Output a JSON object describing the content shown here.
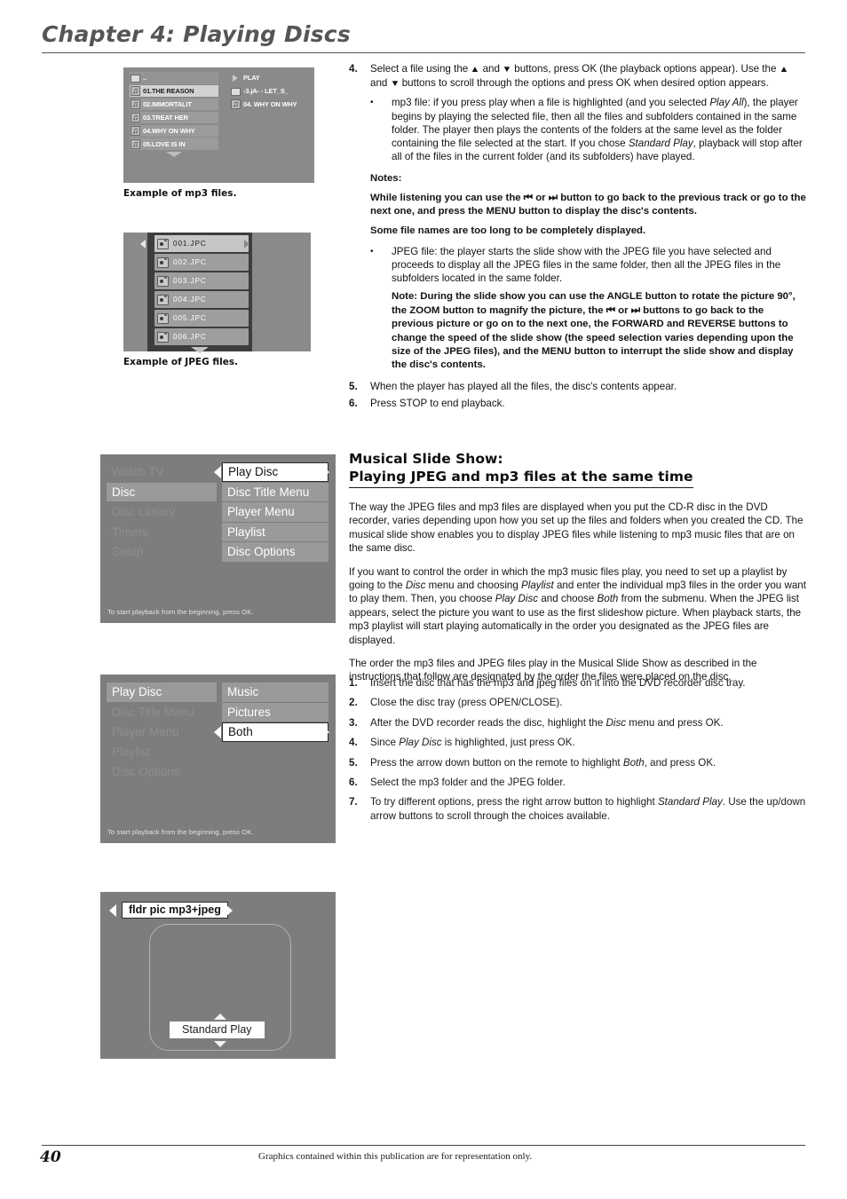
{
  "header": {
    "chapter_title": "Chapter 4: Playing Discs"
  },
  "figures": {
    "mp3": {
      "caption": "Example of mp3 files.",
      "left_list": [
        {
          "label": "..",
          "icon": "folder-icon",
          "selected": false
        },
        {
          "label": "01.THE REASON",
          "icon": "music-note-icon",
          "selected": true
        },
        {
          "label": "02.IMMORTALIT",
          "icon": "music-note-icon",
          "selected": false
        },
        {
          "label": "03.TREAT HER",
          "icon": "music-note-icon",
          "selected": false
        },
        {
          "label": "04.WHY ON WHY",
          "icon": "music-note-icon",
          "selected": false
        },
        {
          "label": "05.LOVE IS IN",
          "icon": "music-note-icon",
          "selected": false
        }
      ],
      "right_list": [
        {
          "label": "PLAY",
          "icon": "play-icon"
        },
        {
          "label": "-3.jA- - LET_S_",
          "icon": "folder-icon"
        },
        {
          "label": "04. WHY ON WHY",
          "icon": "music-note-icon"
        }
      ]
    },
    "jpeg": {
      "caption": "Example of JPEG files.",
      "files": [
        {
          "label": "001.JPC",
          "selected": true
        },
        {
          "label": "002.JPC",
          "selected": false
        },
        {
          "label": "003.JPC",
          "selected": false
        },
        {
          "label": "004.JPC",
          "selected": false
        },
        {
          "label": "005.JPC",
          "selected": false
        },
        {
          "label": "006.JPC",
          "selected": false
        }
      ]
    },
    "disc_menu": {
      "left_items": [
        {
          "label": "Watch TV",
          "state": "dim"
        },
        {
          "label": "Disc",
          "state": "active"
        },
        {
          "label": "Disc Library",
          "state": "dim"
        },
        {
          "label": "Timers",
          "state": "dim"
        },
        {
          "label": "Setup",
          "state": "dim"
        }
      ],
      "right_items": [
        {
          "label": "Play Disc",
          "state": "selected"
        },
        {
          "label": "Disc Title Menu",
          "state": "listed"
        },
        {
          "label": "Player Menu",
          "state": "listed"
        },
        {
          "label": "Playlist",
          "state": "listed"
        },
        {
          "label": "Disc Options",
          "state": "listed"
        }
      ],
      "hint": "To start playback from the beginning, press OK."
    },
    "play_disc_menu": {
      "left_items": [
        {
          "label": "Play Disc",
          "state": "active"
        },
        {
          "label": "Disc Title Menu",
          "state": "dim"
        },
        {
          "label": "Player Menu",
          "state": "dim"
        },
        {
          "label": "Playlist",
          "state": "dim"
        },
        {
          "label": "Disc Options",
          "state": "dim"
        }
      ],
      "right_items": [
        {
          "label": "Music",
          "state": "listed"
        },
        {
          "label": "Pictures",
          "state": "listed"
        },
        {
          "label": "Both",
          "state": "selected"
        }
      ],
      "hint": "To start playback from the beginning, press OK."
    },
    "slideshow": {
      "folder_label": "fldr pic mp3+jpeg",
      "play_mode_label": "Standard Play"
    }
  },
  "instructions": {
    "step4_num": "4.",
    "step4_text_a": "Select a file using the ",
    "step4_text_b": " and ",
    "step4_text_c": " buttons, press OK (the playback options appear). Use the ",
    "step4_text_d": " and ",
    "step4_text_e": " buttons to scroll through the options and press OK when desired option appears.",
    "bullet_mp3_a": "mp3 file: if you press play when a file is highlighted (and you selected ",
    "bullet_mp3_i1": "Play All",
    "bullet_mp3_b": "), the player begins by playing the selected file, then all the files and subfolders contained in the same folder. The player then plays the contents of the folders at the same level as the folder containing the file selected at the start. If you chose ",
    "bullet_mp3_i2": "Standard Play",
    "bullet_mp3_c": ", playback will stop after all of the files in the current folder (and its subfolders) have played.",
    "notes_label": "Notes:",
    "note1_a": "While listening you can use the ",
    "note1_b": " or ",
    "note1_c": " button to go back to the previous track or go to the next one, and press the MENU button to display the disc's contents.",
    "note2": "Some file names are too long to be completely displayed.",
    "bullet_jpeg": "JPEG file: the player starts the slide show with the JPEG file you have selected and proceeds to display all the JPEG files in the same folder, then all the JPEG files in the subfolders located in the same folder.",
    "note3_a": "Note: During the slide show you can use the ANGLE button to rotate the picture 90°, the ZOOM button to magnify the picture, the ",
    "note3_b": " or ",
    "note3_c": " buttons to go back to the previous picture or go on to the next one, the FORWARD and REVERSE buttons to change the speed of the slide show (the speed selection varies depending upon the size of the JPEG files), and the MENU button to interrupt the slide show and display the disc's contents.",
    "step5_num": "5.",
    "step5_text": "When the player has played all the files, the disc's contents appear.",
    "step6_num": "6.",
    "step6_text": "Press STOP to end playback."
  },
  "section": {
    "heading_line1": "Musical Slide Show:",
    "heading_line2": "Playing JPEG and mp3 files at the same time",
    "para1": "The way the JPEG files and mp3 files are displayed when you put the CD-R disc in the DVD recorder, varies depending upon how you set up the files and folders when you created the CD. The musical slide show enables you to display JPEG files while listening to mp3 music files that are on the same disc.",
    "para2_a": "If you want to control the order in which the mp3 music files play, you need to set up a playlist by going to the ",
    "para2_i1": "Disc",
    "para2_b": " menu and choosing ",
    "para2_i2": "Playlist",
    "para2_c": " and enter the individual mp3 files in the order you want to play them. Then, you choose ",
    "para2_i3": "Play Disc",
    "para2_d": " and choose ",
    "para2_i4": "Both",
    "para2_e": " from the submenu. When the JPEG list appears, select the picture you want to use as the first slideshow picture. When playback starts, the mp3 playlist will start playing automatically in the order you designated as the JPEG files are displayed.",
    "para3": "The order the mp3 files and JPEG files play in the Musical Slide Show as described in the instructions that follow are designated by the order the files were placed on the disc."
  },
  "steps": {
    "s1_num": "1.",
    "s1_text": "Insert the disc that has the mp3 and jpeg files on it into the DVD recorder disc tray.",
    "s2_num": "2.",
    "s2_text": "Close the disc tray (press OPEN/CLOSE).",
    "s3_num": "3.",
    "s3_a": "After the DVD recorder reads the disc, highlight the ",
    "s3_i": "Disc",
    "s3_b": " menu and press OK.",
    "s4_num": "4.",
    "s4_a": "Since ",
    "s4_i": "Play Disc",
    "s4_b": " is highlighted, just press OK.",
    "s5_num": "5.",
    "s5_a": "Press the arrow down button on the remote to highlight ",
    "s5_i": "Both",
    "s5_b": ", and press OK.",
    "s6_num": "6.",
    "s6_text": "Select the mp3 folder and the JPEG folder.",
    "s7_num": "7.",
    "s7_a": "To try different options, press the right arrow button to highlight ",
    "s7_i": "Standard Play",
    "s7_b": ". Use the up/down arrow buttons to scroll through the choices available."
  },
  "footer": {
    "page_number": "40",
    "note": "Graphics contained within this publication are for representation only."
  }
}
